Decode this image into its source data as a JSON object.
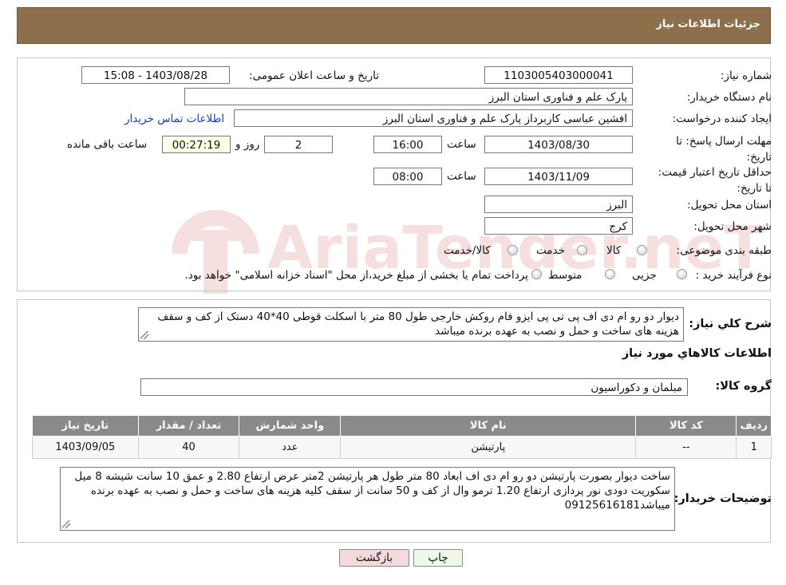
{
  "header": {
    "title": "جزئیات اطلاعات نیاز"
  },
  "form": {
    "need_number_label": "شماره نیاز:",
    "need_number": "1103005403000041",
    "announce_label": "تاریخ و ساعت اعلان عمومی:",
    "announce_value": "1403/08/28 - 15:08",
    "buyer_org_label": "نام دستگاه خریدار:",
    "buyer_org": "پارک علم و فناوری استان البرز",
    "requester_label": "ایجاد کننده درخواست:",
    "requester": "افشین  عباسی  کاربرداز پارک علم و فناوری استان البرز",
    "contact_link": "اطلاعات تماس خریدار",
    "deadline_label": "مهلت ارسال پاسخ: تا تاریخ:",
    "deadline_date": "1403/08/30",
    "time_label": "ساعت",
    "deadline_time": "16:00",
    "days_value": "2",
    "days_label": "روز و",
    "remaining_value": "00:27:19",
    "remaining_label": "ساعت باقی مانده",
    "validity_label": "حداقل تاریخ اعتبار قیمت: تا تاریخ:",
    "validity_date": "1403/11/09",
    "validity_time": "08:00",
    "province_label": "استان محل تحویل:",
    "province": "البرز",
    "city_label": "شهر محل تحویل:",
    "city": "کرج",
    "category_label": "طبقه بندی موضوعی:",
    "category_options": [
      "کالا",
      "خدمت",
      "کالا/خدمت"
    ],
    "process_label": "نوع فرآیند خرید :",
    "process_options": [
      "جزیی",
      "متوسط"
    ],
    "process_note": "پرداخت تمام یا بخشی از مبلغ خرید،از محل \"اسناد خزانه اسلامی\" خواهد بود."
  },
  "description": {
    "label": "شرح کلي نياز:",
    "text": "دیوار دو رو ام دی اف پی تی پی ایزو فام روکش خارجی طول 80 متر  با اسکلت  قوطی 40*40 دستک از کف و سقف هزینه های ساخت و حمل و نصب به عهده برنده میباشد"
  },
  "goods": {
    "section_title": "اطلاعات کالاهاي مورد نياز",
    "group_label": "گروه کالا:",
    "group_value": "مبلمان و دکوراسیون",
    "columns": [
      "رديف",
      "کد کالا",
      "نام کالا",
      "واحد شمارش",
      "تعداد / مقدار",
      "تاریخ نیاز"
    ],
    "rows": [
      [
        "1",
        "--",
        "پارتیشن",
        "عدد",
        "40",
        "1403/09/05"
      ]
    ]
  },
  "buyer_notes": {
    "label": "توضیحات خریدار:",
    "text": "ساخت دیوار بصورت پارتیشن دو رو ام دی اف  ابعاد 80 متر طول  هر پارتیشن 2متر عرض ارتفاع 2.80 و عمق 10 سانت شیشه 8 میل سکوریت دودی نور پردازی ارتفاع 1.20 ترمو وال از کف و 50 سانت از سقف کلیه هزینه های ساخت و حمل و نصب به عهده برنده میباشد09125616181"
  },
  "buttons": {
    "print": "چاپ",
    "back": "بازگشت"
  },
  "watermark": {
    "text": "AriaTender.neT"
  },
  "colors": {
    "header": "#8d6f4c",
    "table_header": "#8a8a8a",
    "back_button": "#f6d9dc",
    "print_button": "#eef7e8"
  }
}
